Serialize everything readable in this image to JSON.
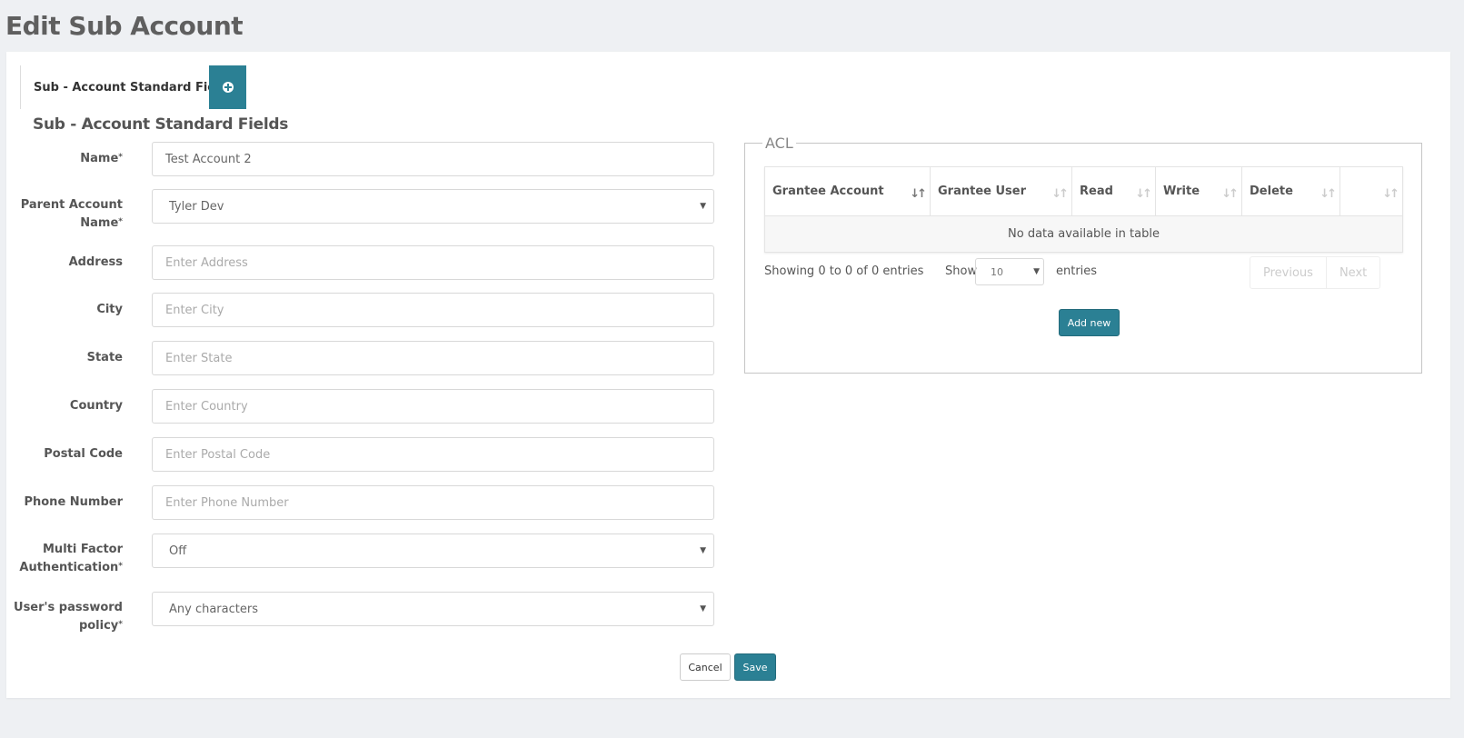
{
  "page": {
    "title": "Edit Sub Account"
  },
  "tabs": {
    "active_label": "Sub - Account Standard Fields",
    "add_icon": "plus-circle-icon"
  },
  "form": {
    "section_title": "Sub - Account Standard Fields",
    "required_mark": "*",
    "fields": {
      "name": {
        "label": "Name",
        "value": "Test Account 2",
        "placeholder": ""
      },
      "parent_account": {
        "label_line1": "Parent Account",
        "label_line2": "Name",
        "value": "Tyler Dev"
      },
      "address": {
        "label": "Address",
        "value": "",
        "placeholder": "Enter Address"
      },
      "city": {
        "label": "City",
        "value": "",
        "placeholder": "Enter City"
      },
      "state": {
        "label": "State",
        "value": "",
        "placeholder": "Enter State"
      },
      "country": {
        "label": "Country",
        "value": "",
        "placeholder": "Enter Country"
      },
      "postal_code": {
        "label": "Postal Code",
        "value": "",
        "placeholder": "Enter Postal Code"
      },
      "phone": {
        "label": "Phone Number",
        "value": "",
        "placeholder": "Enter Phone Number"
      },
      "mfa": {
        "label_line1": "Multi Factor",
        "label_line2": "Authentication",
        "value": "Off"
      },
      "password_policy": {
        "label_line1": "User's password",
        "label_line2": "policy",
        "value": "Any characters"
      }
    },
    "cancel_label": "Cancel",
    "save_label": "Save"
  },
  "acl": {
    "legend": "ACL",
    "columns": [
      "Grantee Account",
      "Grantee User",
      "Read",
      "Write",
      "Delete",
      ""
    ],
    "empty_message": "No data available in table",
    "info": "Showing 0 to 0 of 0 entries",
    "show_label": "Show",
    "page_length": "10",
    "entries_label": "entries",
    "previous_label": "Previous",
    "next_label": "Next",
    "add_new_label": "Add new"
  },
  "colors": {
    "accent": "#2b8094",
    "background": "#eef0f3"
  }
}
